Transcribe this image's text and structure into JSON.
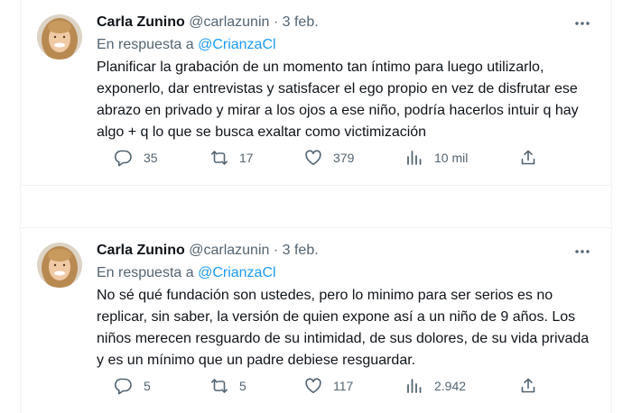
{
  "tweets": [
    {
      "name": "Carla Zunino",
      "handle": "@carlazunin",
      "dot": "·",
      "date": "3 feb.",
      "reply_prefix": "En respuesta a",
      "reply_to": "@CrianzaCl",
      "text": "Planificar la grabación de un momento tan íntimo para luego utilizarlo, exponerlo, dar entrevistas y satisfacer el ego propio en vez de disfrutar ese abrazo en privado y mirar a los ojos a ese niño, podría hacerlos intuir q hay algo + q lo que se busca exaltar como victimización",
      "replies": "35",
      "retweets": "17",
      "likes": "379",
      "views": "10 mil"
    },
    {
      "name": "Carla Zunino",
      "handle": "@carlazunin",
      "dot": "·",
      "date": "3 feb.",
      "reply_prefix": "En respuesta a",
      "reply_to": "@CrianzaCl",
      "text": "No sé qué fundación son ustedes, pero lo minimo para ser serios es no replicar, sin saber, la versión de quien expone así a un niño de 9 años. Los niños merecen resguardo de su intimidad, de sus dolores, de su vida privada y es un mínimo que un padre debiese resguardar.",
      "replies": "5",
      "retweets": "5",
      "likes": "117",
      "views": "2.942"
    }
  ],
  "colors": {
    "text": "#0f1419",
    "secondary": "#536471",
    "link": "#1d9bf0",
    "border": "#eff3f4"
  },
  "icons": {
    "more": "more-dots-icon",
    "reply": "reply-bubble-icon",
    "retweet": "retweet-icon",
    "like": "heart-icon",
    "views": "bar-chart-icon",
    "share": "share-icon"
  }
}
